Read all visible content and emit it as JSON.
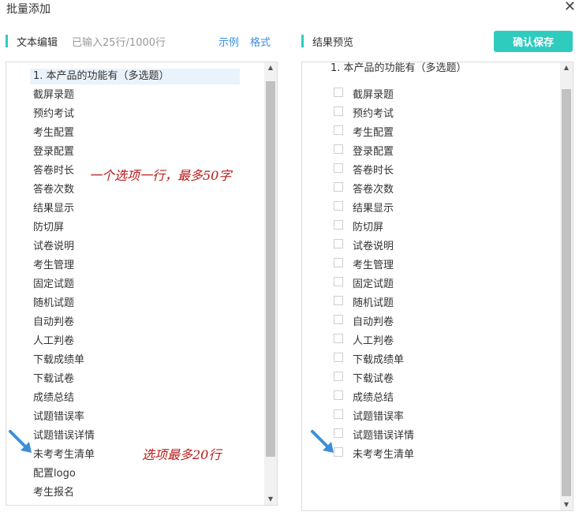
{
  "window": {
    "title": "批量添加",
    "close_icon": "close-icon"
  },
  "editor": {
    "title": "文本编辑",
    "count": "已输入25行/1000行",
    "link_example": "示例",
    "link_format": "格式",
    "lines": [
      "1. 本产品的功能有（多选题）",
      "截屏录题",
      "预约考试",
      "考生配置",
      "登录配置",
      "答卷时长",
      "答卷次数",
      "结果显示",
      "防切屏",
      "试卷说明",
      "考生管理",
      "固定试题",
      "随机试题",
      "自动判卷",
      "人工判卷",
      "下载成绩单",
      "下载试卷",
      "成绩总结",
      "试题错误率",
      "试题错误详情",
      "未考考生清单",
      "配置logo",
      "考生报名"
    ]
  },
  "preview": {
    "title": "结果预览",
    "save_button": "确认保存",
    "question": "1. 本产品的功能有（多选题）",
    "options": [
      "截屏录题",
      "预约考试",
      "考生配置",
      "登录配置",
      "答卷时长",
      "答卷次数",
      "结果显示",
      "防切屏",
      "试卷说明",
      "考生管理",
      "固定试题",
      "随机试题",
      "自动判卷",
      "人工判卷",
      "下载成绩单",
      "下载试卷",
      "成绩总结",
      "试题错误率",
      "试题错误详情",
      "未考考生清单"
    ]
  },
  "annotations": {
    "note_one_line": "一个选项一行，最多50字",
    "note_max_rows": "选项最多20行"
  },
  "colors": {
    "accent": "#2ecbbf",
    "link": "#3d8de0",
    "annotation": "#b91a1a",
    "arrow": "#3b8fd9"
  }
}
